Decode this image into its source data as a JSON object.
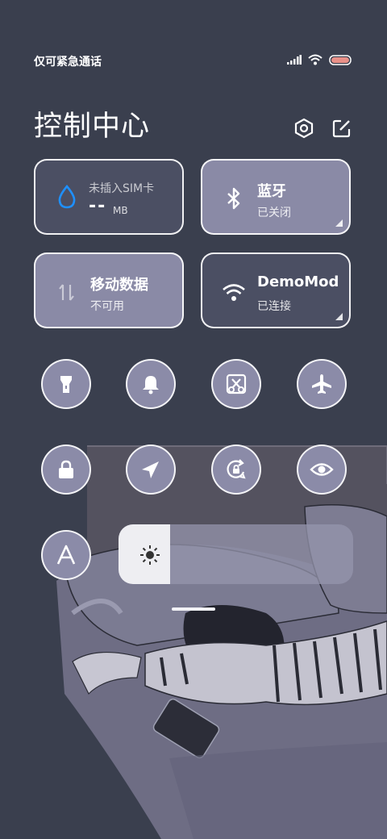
{
  "status_bar": {
    "carrier_text": "仅可紧急通话",
    "icons": [
      "signal-icon",
      "wifi-icon",
      "battery-icon"
    ],
    "battery_color": "#e89088"
  },
  "header": {
    "title": "控制中心",
    "icons": [
      "settings-icon",
      "edit-icon"
    ]
  },
  "tiles": {
    "data_usage": {
      "label": "未插入SIM卡",
      "value": "--",
      "unit": "MB",
      "icon": "water-drop-icon",
      "icon_color": "#1e90ff"
    },
    "bluetooth": {
      "label": "蓝牙",
      "status": "已关闭",
      "icon": "bluetooth-icon"
    },
    "mobile_data": {
      "label": "移动数据",
      "status": "不可用",
      "icon": "data-arrows-icon"
    },
    "wifi": {
      "label": "DemoMode",
      "status": "已连接",
      "icon": "wifi-icon"
    }
  },
  "toggles": [
    {
      "name": "flashlight",
      "icon": "flashlight-icon"
    },
    {
      "name": "ringtone",
      "icon": "bell-icon"
    },
    {
      "name": "screenshot",
      "icon": "scissors-screenshot-icon"
    },
    {
      "name": "airplane",
      "icon": "airplane-icon"
    },
    {
      "name": "lock-screen",
      "icon": "lock-icon"
    },
    {
      "name": "location",
      "icon": "location-arrow-icon"
    },
    {
      "name": "rotation-lock",
      "icon": "rotate-lock-icon"
    },
    {
      "name": "reading-mode",
      "icon": "eye-icon"
    },
    {
      "name": "auto-brightness",
      "icon": "letter-a-icon"
    }
  ],
  "brightness": {
    "level": 0.22,
    "icon": "sun-icon"
  },
  "colors": {
    "accent": "#1e90ff",
    "tile_active": "#8b8ba8",
    "background": "#3a3f4e"
  }
}
